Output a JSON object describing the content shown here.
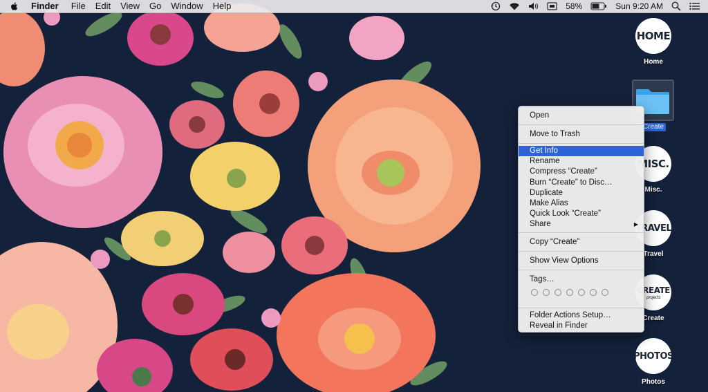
{
  "menubar": {
    "app_name": "Finder",
    "menus": [
      "File",
      "Edit",
      "View",
      "Go",
      "Window",
      "Help"
    ],
    "battery": "58%",
    "clock": "Sun 9:20 AM"
  },
  "desktop": {
    "icons": [
      {
        "badge": "HOME",
        "caption": "Home"
      },
      {
        "badge": "",
        "caption": "Create"
      },
      {
        "badge": "MISC.",
        "caption": "Misc."
      },
      {
        "badge": "TRAVEL",
        "caption": "Travel"
      },
      {
        "badge": "CREATE",
        "sub": "projects",
        "caption": "Create"
      },
      {
        "badge": "PHOTOS",
        "caption": "Photos"
      }
    ]
  },
  "context_menu": {
    "open": "Open",
    "move_to_trash": "Move to Trash",
    "get_info": "Get Info",
    "rename": "Rename",
    "compress": "Compress “Create”",
    "burn": "Burn “Create” to Disc…",
    "duplicate": "Duplicate",
    "make_alias": "Make Alias",
    "quick_look": "Quick Look “Create”",
    "share": "Share",
    "copy": "Copy “Create”",
    "show_view_options": "Show View Options",
    "tags": "Tags…",
    "folder_actions": "Folder Actions Setup…",
    "reveal": "Reveal in Finder"
  },
  "colors": {
    "highlight": "#2a64d6",
    "wallpaper_bg": "#13213a"
  }
}
